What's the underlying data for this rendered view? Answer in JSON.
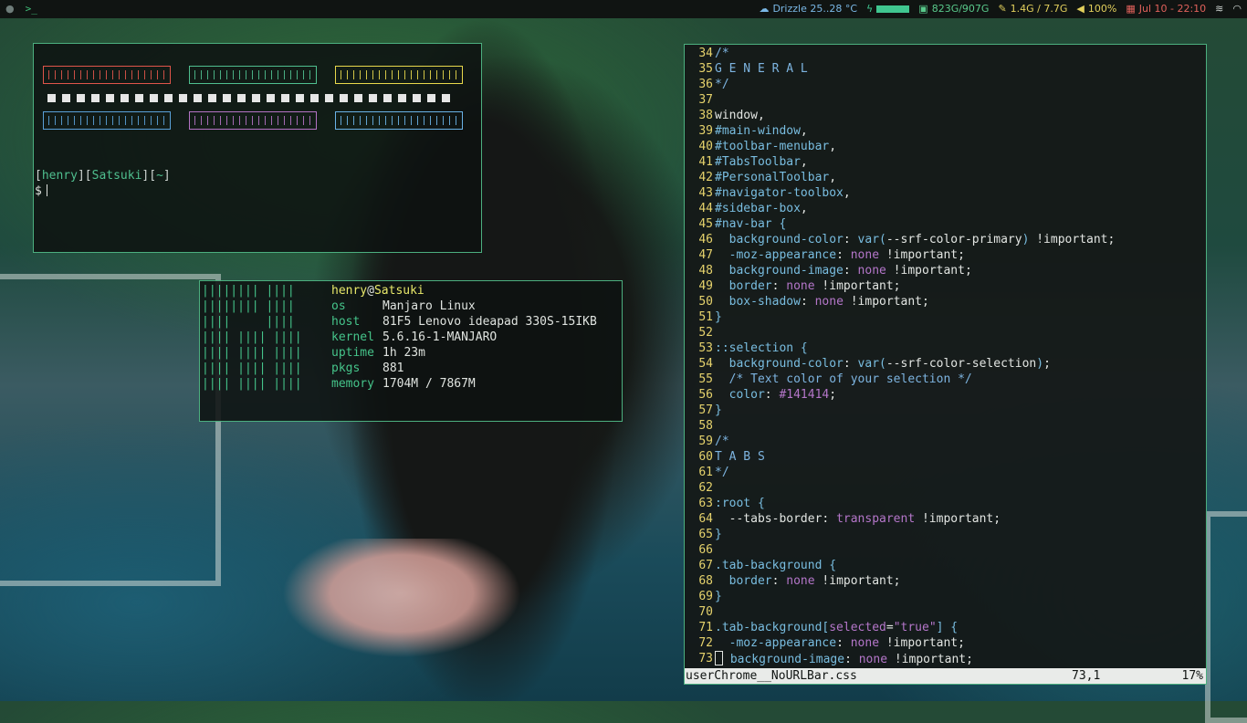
{
  "topbar": {
    "left_icons": [
      "workspace-icon",
      "terminal-icon"
    ],
    "terminal_glyph": ">_",
    "weather": "Drizzle 25..28 °C",
    "disk": "823G/907G",
    "memory": "1.4G / 7.7G",
    "volume": "100%",
    "datetime": "Jul 10 - 22:10",
    "colors": {
      "weather": "#7ab8e6",
      "disk": "#59c98b",
      "memory": "#e2cf5c",
      "volume": "#e2cf5c",
      "datetime": "#e0615b"
    }
  },
  "terminal": {
    "color_blocks": {
      "row1": [
        "#e0554a",
        "#4fbf8f",
        "#e8d84c"
      ],
      "row2": [
        "#5aa0d8",
        "#b473c4",
        "#6ab2e6"
      ]
    },
    "prompt_user": "henry",
    "prompt_host": "Satsuki",
    "prompt_dir": "~",
    "prompt_symbol": "$"
  },
  "fetch": {
    "user": "henry",
    "at": "@",
    "host": "Satsuki",
    "art": [
      "|||||||| ||||",
      "|||||||| ||||",
      "||||     ||||",
      "|||| |||| ||||",
      "|||| |||| ||||",
      "|||| |||| ||||",
      "|||| |||| ||||"
    ],
    "info": [
      {
        "key": "os",
        "value": "Manjaro Linux"
      },
      {
        "key": "host",
        "value": "81F5 Lenovo ideapad 330S-15IKB"
      },
      {
        "key": "kernel",
        "value": "5.6.16-1-MANJARO"
      },
      {
        "key": "uptime",
        "value": "1h 23m"
      },
      {
        "key": "pkgs",
        "value": "881"
      },
      {
        "key": "memory",
        "value": "1704M / 7867M"
      }
    ]
  },
  "editor": {
    "filename": "userChrome__NoURLBar.css",
    "position": "73,1",
    "percent": "17%",
    "lines": [
      {
        "n": "34",
        "t": [
          [
            "comment",
            "/*"
          ]
        ]
      },
      {
        "n": "35",
        "t": [
          [
            "comment",
            "G E N E R A L"
          ]
        ]
      },
      {
        "n": "36",
        "t": [
          [
            "comment",
            "*/"
          ]
        ]
      },
      {
        "n": "37",
        "t": []
      },
      {
        "n": "38",
        "t": [
          [
            "plain",
            "window,"
          ]
        ]
      },
      {
        "n": "39",
        "t": [
          [
            "prop",
            "#main-window"
          ],
          [
            "plain",
            ","
          ]
        ]
      },
      {
        "n": "40",
        "t": [
          [
            "prop",
            "#toolbar-menubar"
          ],
          [
            "plain",
            ","
          ]
        ]
      },
      {
        "n": "41",
        "t": [
          [
            "prop",
            "#TabsToolbar"
          ],
          [
            "plain",
            ","
          ]
        ]
      },
      {
        "n": "42",
        "t": [
          [
            "prop",
            "#PersonalToolbar"
          ],
          [
            "plain",
            ","
          ]
        ]
      },
      {
        "n": "43",
        "t": [
          [
            "prop",
            "#navigator-toolbox"
          ],
          [
            "plain",
            ","
          ]
        ]
      },
      {
        "n": "44",
        "t": [
          [
            "prop",
            "#sidebar-box"
          ],
          [
            "plain",
            ","
          ]
        ]
      },
      {
        "n": "45",
        "t": [
          [
            "prop",
            "#nav-bar {"
          ]
        ]
      },
      {
        "n": "46",
        "t": [
          [
            "plain",
            "  "
          ],
          [
            "prop",
            "background-color"
          ],
          [
            "plain",
            ": "
          ],
          [
            "prop",
            "var("
          ],
          [
            "plain",
            "--srf-color-primary"
          ],
          [
            "prop",
            ")"
          ],
          [
            "plain",
            " !important;"
          ]
        ]
      },
      {
        "n": "47",
        "t": [
          [
            "plain",
            "  "
          ],
          [
            "prop",
            "-moz-appearance"
          ],
          [
            "plain",
            ": "
          ],
          [
            "val",
            "none"
          ],
          [
            "plain",
            " !important;"
          ]
        ]
      },
      {
        "n": "48",
        "t": [
          [
            "plain",
            "  "
          ],
          [
            "prop",
            "background-image"
          ],
          [
            "plain",
            ": "
          ],
          [
            "val",
            "none"
          ],
          [
            "plain",
            " !important;"
          ]
        ]
      },
      {
        "n": "49",
        "t": [
          [
            "plain",
            "  "
          ],
          [
            "prop",
            "border"
          ],
          [
            "plain",
            ": "
          ],
          [
            "val",
            "none"
          ],
          [
            "plain",
            " !important;"
          ]
        ]
      },
      {
        "n": "50",
        "t": [
          [
            "plain",
            "  "
          ],
          [
            "prop",
            "box-shadow"
          ],
          [
            "plain",
            ": "
          ],
          [
            "val",
            "none"
          ],
          [
            "plain",
            " !important;"
          ]
        ]
      },
      {
        "n": "51",
        "t": [
          [
            "prop",
            "}"
          ]
        ]
      },
      {
        "n": "52",
        "t": []
      },
      {
        "n": "53",
        "t": [
          [
            "prop",
            "::selection {"
          ]
        ]
      },
      {
        "n": "54",
        "t": [
          [
            "plain",
            "  "
          ],
          [
            "prop",
            "background-color"
          ],
          [
            "plain",
            ": "
          ],
          [
            "prop",
            "var("
          ],
          [
            "plain",
            "--srf-color-selection"
          ],
          [
            "prop",
            ")"
          ],
          [
            "plain",
            ";"
          ]
        ]
      },
      {
        "n": "55",
        "t": [
          [
            "plain",
            "  "
          ],
          [
            "comment",
            "/* Text color of your selection */"
          ]
        ]
      },
      {
        "n": "56",
        "t": [
          [
            "plain",
            "  "
          ],
          [
            "prop",
            "color"
          ],
          [
            "plain",
            ": "
          ],
          [
            "val",
            "#141414"
          ],
          [
            "plain",
            ";"
          ]
        ]
      },
      {
        "n": "57",
        "t": [
          [
            "prop",
            "}"
          ]
        ]
      },
      {
        "n": "58",
        "t": []
      },
      {
        "n": "59",
        "t": [
          [
            "comment",
            "/*"
          ]
        ]
      },
      {
        "n": "60",
        "t": [
          [
            "comment",
            "T A B S"
          ]
        ]
      },
      {
        "n": "61",
        "t": [
          [
            "comment",
            "*/"
          ]
        ]
      },
      {
        "n": "62",
        "t": []
      },
      {
        "n": "63",
        "t": [
          [
            "prop",
            ":root {"
          ]
        ]
      },
      {
        "n": "64",
        "t": [
          [
            "plain",
            "  --tabs-border: "
          ],
          [
            "val",
            "transparent"
          ],
          [
            "plain",
            " !important;"
          ]
        ]
      },
      {
        "n": "65",
        "t": [
          [
            "prop",
            "}"
          ]
        ]
      },
      {
        "n": "66",
        "t": []
      },
      {
        "n": "67",
        "t": [
          [
            "prop",
            ".tab-background {"
          ]
        ]
      },
      {
        "n": "68",
        "t": [
          [
            "plain",
            "  "
          ],
          [
            "prop",
            "border"
          ],
          [
            "plain",
            ": "
          ],
          [
            "val",
            "none"
          ],
          [
            "plain",
            " !important;"
          ]
        ]
      },
      {
        "n": "69",
        "t": [
          [
            "prop",
            "}"
          ]
        ]
      },
      {
        "n": "70",
        "t": []
      },
      {
        "n": "71",
        "t": [
          [
            "prop",
            ".tab-background["
          ],
          [
            "val",
            "selected"
          ],
          [
            "plain",
            "="
          ],
          [
            "val",
            "\"true\""
          ],
          [
            "prop",
            "] {"
          ]
        ]
      },
      {
        "n": "72",
        "t": [
          [
            "plain",
            "  "
          ],
          [
            "prop",
            "-moz-appearance"
          ],
          [
            "plain",
            ": "
          ],
          [
            "val",
            "none"
          ],
          [
            "plain",
            " !important;"
          ]
        ]
      },
      {
        "n": "73",
        "caret": true,
        "t": [
          [
            "plain",
            " "
          ],
          [
            "prop",
            "background-image"
          ],
          [
            "plain",
            ": "
          ],
          [
            "val",
            "none"
          ],
          [
            "plain",
            " !important;"
          ]
        ]
      }
    ]
  }
}
